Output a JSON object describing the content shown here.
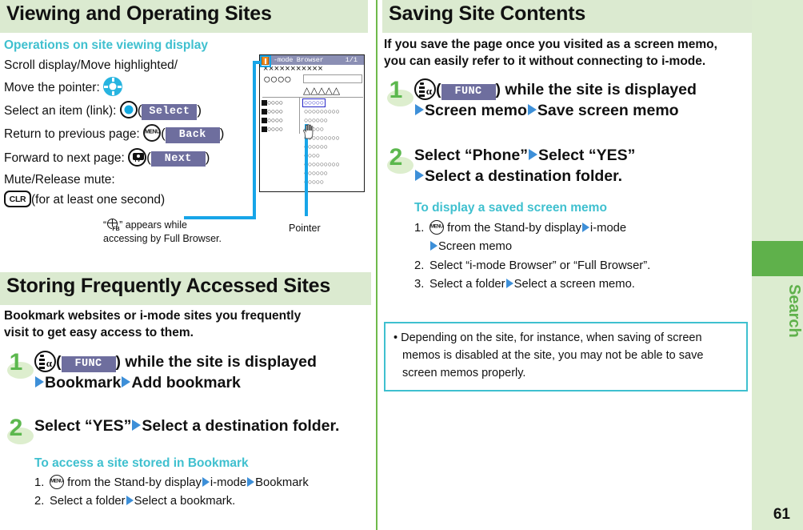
{
  "page": {
    "number": "61",
    "sidebar_label": "Search"
  },
  "left_column": {
    "section_title": "Viewing and Operating Sites",
    "subhead": "Operations on site viewing display",
    "operations": [
      {
        "label_line1": "Scroll display/Move highlighted/",
        "label_line2": "Move the pointer:",
        "key": "dpad",
        "softkey": ""
      },
      {
        "label": "Select an item (link):",
        "key": "select",
        "softkey": "Select"
      },
      {
        "label": "Return to previous page:",
        "key": "menu",
        "softkey": "Back"
      },
      {
        "label": "Forward to next page:",
        "key": "camera-tv",
        "softkey": "Next"
      },
      {
        "label_line1": "Mute/Release mute:",
        "key": "clr",
        "key_label": "CLR",
        "suffix": "(for at least one second)"
      }
    ],
    "phone_screen": {
      "title": "-mode Browser",
      "page_indicator": "1/1",
      "x_row": "×××××××××××",
      "circles_row": "○○○○",
      "triangle_row": "△△△△△",
      "menu_items": [
        "○○○○",
        "○○○○",
        "○○○○",
        "○○○○"
      ],
      "content_rows": [
        "○○○○○",
        "○○○○○○○○○",
        "○○○○○○",
        "○○○○○",
        "○○○○○○○○○",
        "○○○○○○",
        "○○○○",
        "○○○○○○○○○",
        "○○○○○○",
        "○○○○○",
        "○○○○○○○○○",
        "○○○○○○",
        "○○○○"
      ]
    },
    "caption_fb_line1": "” appears while",
    "caption_fb_open": "“",
    "caption_fb_line2": "accessing by Full Browser.",
    "caption_pointer": "Pointer",
    "section2_title": "Storing Frequently Accessed Sites",
    "section2_intro_line1": "Bookmark websites or i-mode sites you frequently",
    "section2_intro_line2": "visit to get easy access to them.",
    "step1": {
      "number": "1",
      "softkey": "FUNC",
      "text_after_key": ") while the site is displayed",
      "line2_a": "Bookmark",
      "line2_b": "Add bookmark"
    },
    "step2": {
      "number": "2",
      "text_a": "Select “YES”",
      "text_b": "Select a destination folder."
    },
    "sub_heading": "To access a site stored in Bookmark",
    "sub_items": [
      {
        "num": "1.",
        "before_key": "",
        "after_key": "from the Stand-by display",
        "arrow1": "i-mode",
        "arrow2": "Bookmark"
      },
      {
        "num": "2.",
        "text_a": "Select a folder",
        "text_b": "Select a bookmark."
      }
    ]
  },
  "right_column": {
    "section_title": "Saving Site Contents",
    "intro_line1": "If you save the page once you visited as a screen memo,",
    "intro_line2": "you can easily refer to it without connecting to i-mode.",
    "step1": {
      "number": "1",
      "softkey": "FUNC",
      "text_after_key": ") while the site is displayed",
      "line2_a": "Screen memo",
      "line2_b": "Save screen memo"
    },
    "step2": {
      "number": "2",
      "line1_a": "Select “Phone”",
      "line1_b": "Select “YES”",
      "line2": "Select a destination folder."
    },
    "sub_heading": "To display a saved screen memo",
    "sub_items": [
      {
        "num": "1.",
        "after_key": "from the Stand-by display",
        "arrow1": "i-mode",
        "line2": "Screen memo"
      },
      {
        "num": "2.",
        "text": "Select “i-mode Browser” or “Full Browser”."
      },
      {
        "num": "3.",
        "text_a": "Select a folder",
        "text_b": "Select a screen memo."
      }
    ],
    "note": "Depending on the site, for instance, when saving of screen memos is disabled at the site, you may not be able to save screen memos properly."
  },
  "colors": {
    "section_header_bg": "#dbead0",
    "teal": "#3fc0cf",
    "green_accent": "#5fb14b",
    "sidebar_bg": "#dcecd0",
    "softkey_bg": "#6e6e9e",
    "arrow_blue": "#3d8fd8",
    "leader_blue": "#17a5e8",
    "phone_titlebar": "#8b8fb4",
    "imode_orange": "#f08a1c"
  }
}
